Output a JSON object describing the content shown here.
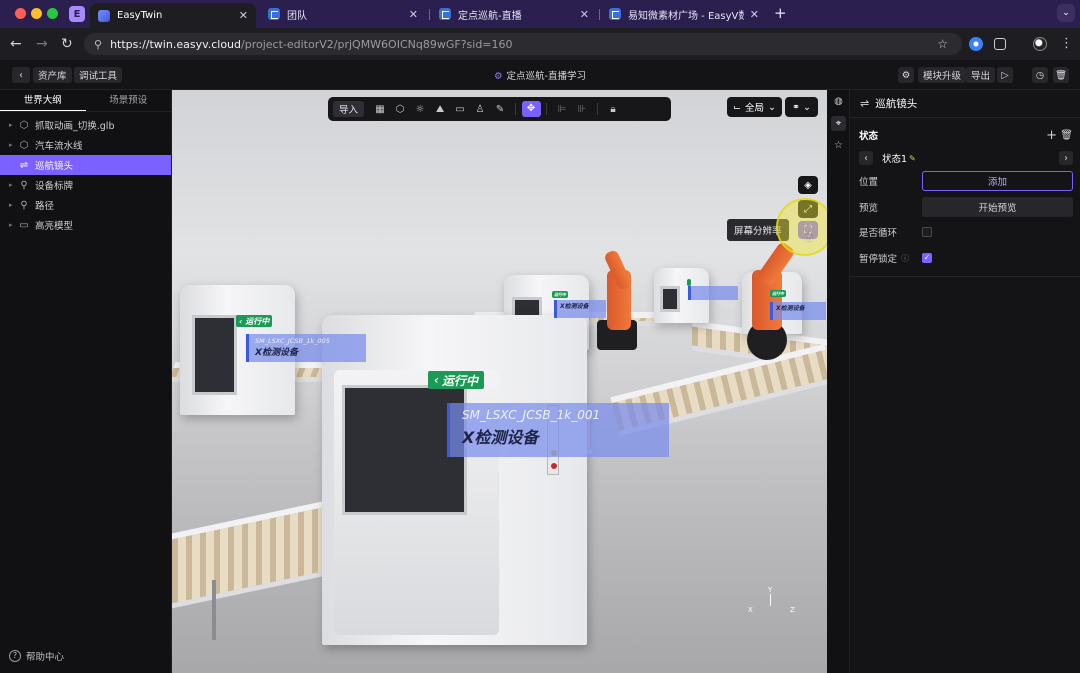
{
  "browser": {
    "profile_letter": "E",
    "tabs": [
      {
        "title": "EasyTwin",
        "active": true
      },
      {
        "title": "团队",
        "active": false
      },
      {
        "title": "定点巡航-直播",
        "active": false
      },
      {
        "title": "易知微素材广场 - EasyV数字孪",
        "active": false
      }
    ],
    "url_host": "https://twin.easyv.cloud",
    "url_path": "/project-editorV2/prjQMW6OICNq89wGF?sid=160"
  },
  "toolbar": {
    "back_icon": "chevron-left-icon",
    "asset_library": "资产库",
    "debug_tools": "调试工具",
    "project_title": "定点巡航-直播学习",
    "module_upgrade": "模块升级",
    "export": "导出"
  },
  "left_panel": {
    "tabs": [
      "世界大纲",
      "场景预设"
    ],
    "tree": [
      {
        "label": "抓取动画_切换.glb",
        "icon": "cube-icon",
        "selected": false
      },
      {
        "label": "汽车流水线",
        "icon": "cube-icon",
        "selected": false
      },
      {
        "label": "巡航镜头",
        "icon": "route-icon",
        "selected": true
      },
      {
        "label": "设备标牌",
        "icon": "tag-icon",
        "selected": false
      },
      {
        "label": "路径",
        "icon": "path-icon",
        "selected": false
      },
      {
        "label": "高亮模型",
        "icon": "folder-icon",
        "selected": false
      }
    ],
    "help": "帮助中心"
  },
  "viewport": {
    "import_label": "导入",
    "global_label": "全局",
    "tooltip": "屏幕分辨率",
    "running_label": "运行中",
    "device_code_main": "SM_LSXC_JCSB_1k_001",
    "device_code_left": "SM_LSXC_JCSB_1k_005",
    "device_name": "X检测设备",
    "axis_y": "Y",
    "axis_x": "X",
    "axis_z": "Z"
  },
  "right_panel": {
    "title": "巡航镜头",
    "state_section": "状态",
    "state_item": "状态1",
    "position_label": "位置",
    "add_button": "添加",
    "preview_label": "预览",
    "start_preview": "开始预览",
    "loop_label": "是否循环",
    "loop_checked": false,
    "pause_lock_label": "暂停锁定",
    "pause_lock_checked": true
  },
  "colors": {
    "accent": "#7b61ff",
    "running_green": "#1a9a55",
    "tab_bar": "#2a1f4e"
  }
}
